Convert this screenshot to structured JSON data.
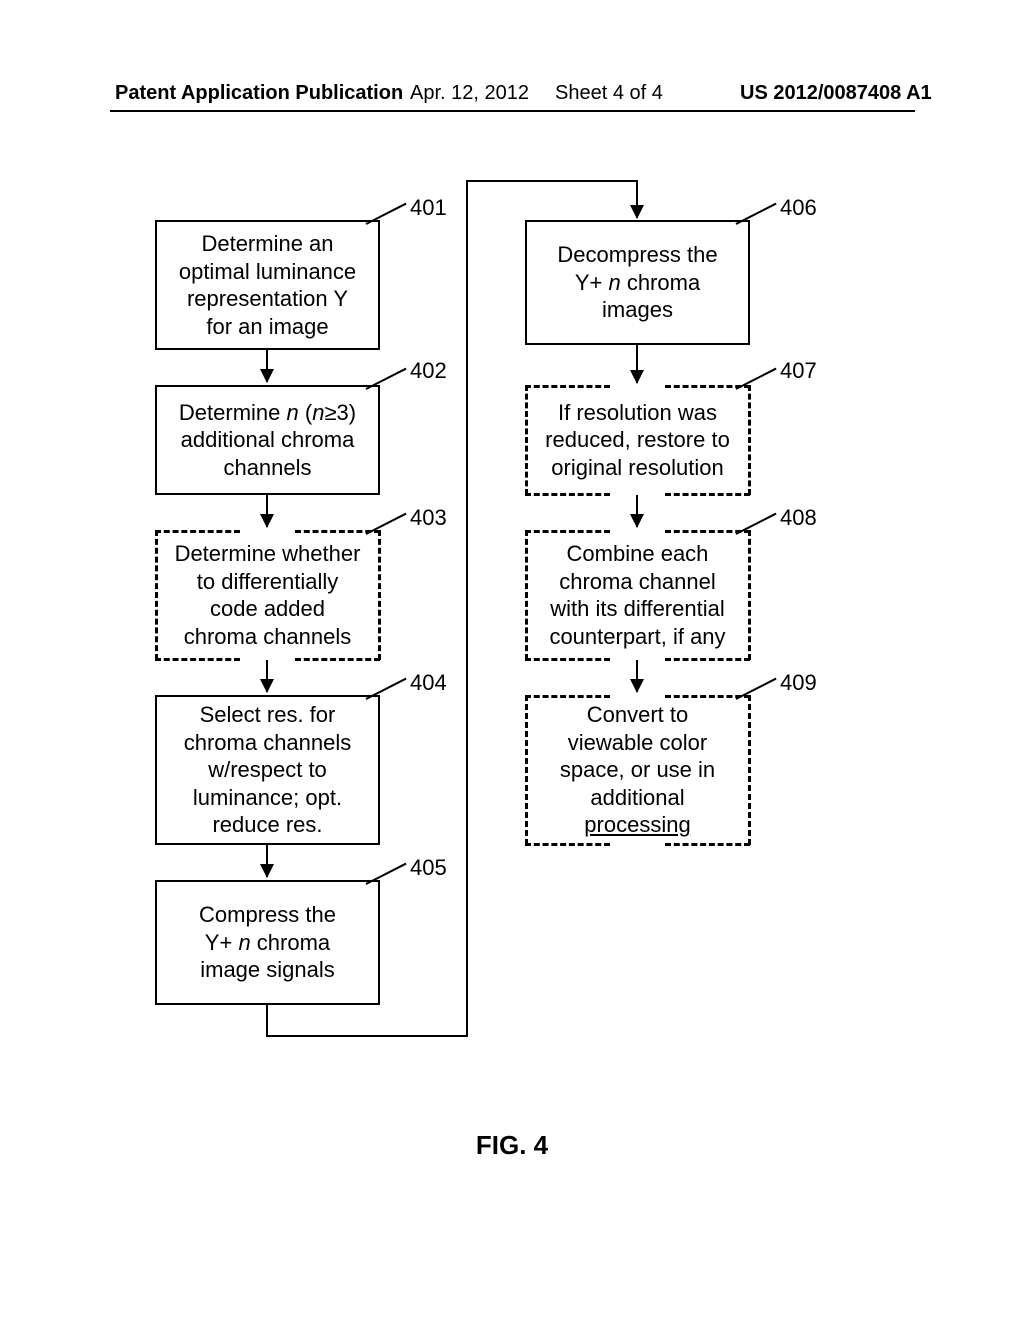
{
  "header": {
    "left": "Patent Application Publication",
    "date": "Apr. 12, 2012",
    "sheet": "Sheet 4 of 4",
    "pubno": "US 2012/0087408 A1"
  },
  "labels": {
    "b401": "401",
    "b402": "402",
    "b403": "403",
    "b404": "404",
    "b405": "405",
    "b406": "406",
    "b407": "407",
    "b408": "408",
    "b409": "409"
  },
  "boxes": {
    "b401_l1": "Determine an",
    "b401_l2": "optimal luminance",
    "b401_l3": "representation Y",
    "b401_l4": "for an image",
    "b402_l1_a": "Determine ",
    "b402_l1_b": "n",
    "b402_l1_c": " (",
    "b402_l1_d": "n",
    "b402_l1_e": "≥3)",
    "b402_l2": "additional chroma",
    "b402_l3": "channels",
    "b403_l1": "Determine whether",
    "b403_l2": "to differentially",
    "b403_l3": "code added",
    "b403_l4": "chroma channels",
    "b404_l1": "Select res. for",
    "b404_l2": "chroma channels",
    "b404_l3": "w/respect to",
    "b404_l4": "luminance; opt.",
    "b404_l5": "reduce res.",
    "b405_l1": "Compress the",
    "b405_l2a": "Y+ ",
    "b405_l2b": "n",
    "b405_l2c": " chroma",
    "b405_l3": "image signals",
    "b406_l1": "Decompress the",
    "b406_l2a": "Y+ ",
    "b406_l2b": "n",
    "b406_l2c": " chroma",
    "b406_l3": "images",
    "b407_l1": "If resolution was",
    "b407_l2": "reduced, restore to",
    "b407_l3": "original resolution",
    "b408_l1": "Combine each",
    "b408_l2": "chroma channel",
    "b408_l3": "with its differential",
    "b408_l4": "counterpart, if any",
    "b409_l1": "Convert to",
    "b409_l2": "viewable color",
    "b409_l3": "space, or use in",
    "b409_l4": "additional",
    "b409_l5": "processing"
  },
  "figure": "FIG. 4"
}
